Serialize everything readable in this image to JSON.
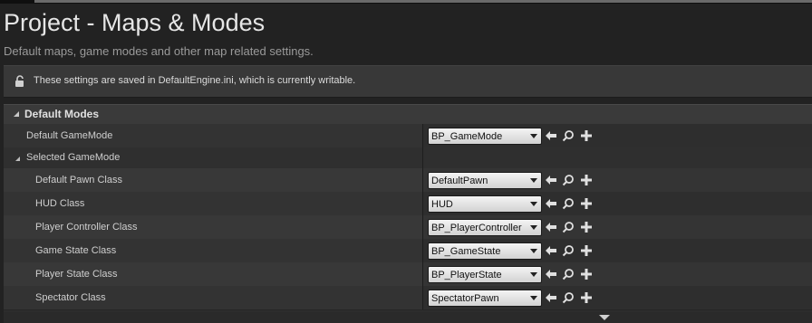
{
  "page": {
    "title": "Project - Maps & Modes",
    "subtitle": "Default maps, game modes and other map related settings."
  },
  "notice": {
    "text": "These settings are saved in DefaultEngine.ini, which is currently writable."
  },
  "category": {
    "label": "Default Modes"
  },
  "rows": [
    {
      "label": "Default GameMode",
      "value": "BP_GameMode"
    },
    {
      "label": "Selected GameMode"
    },
    {
      "label": "Default Pawn Class",
      "value": "DefaultPawn"
    },
    {
      "label": "HUD Class",
      "value": "HUD"
    },
    {
      "label": "Player Controller Class",
      "value": "BP_PlayerController"
    },
    {
      "label": "Game State Class",
      "value": "BP_GameState"
    },
    {
      "label": "Player State Class",
      "value": "BP_PlayerState"
    },
    {
      "label": "Spectator Class",
      "value": "SpectatorPawn"
    }
  ],
  "icons": {
    "use_selected": "arrow-left-icon",
    "browse": "search-icon",
    "new": "plus-icon",
    "notice": "unlock-icon"
  },
  "colors": {
    "background": "#222222",
    "panel": "#2d2d2d",
    "combo_bg": "#e6e6e6",
    "text": "#c8c8c8"
  }
}
